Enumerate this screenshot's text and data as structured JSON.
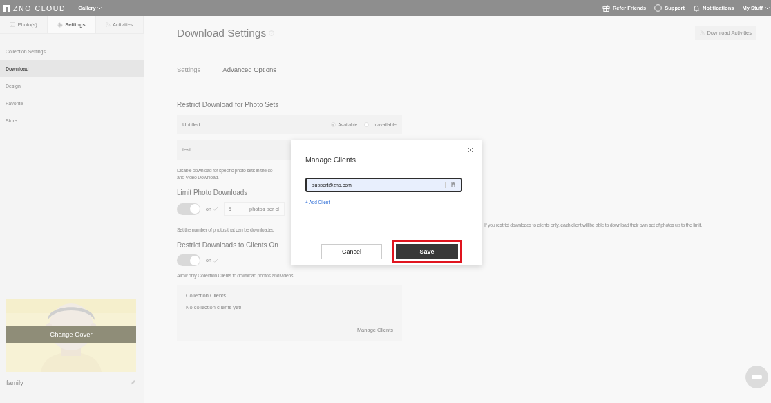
{
  "top_bar": {
    "logo": "ZNO CLOUD",
    "menu": "Gallery",
    "links": [
      {
        "kind": "gift",
        "label": "Refer Friends"
      },
      {
        "kind": "support",
        "label": "Support"
      },
      {
        "kind": "bell",
        "label": "Notifications"
      },
      {
        "kind": "dropdown",
        "label": "My Stuff"
      }
    ]
  },
  "sidebar": {
    "tabs": [
      {
        "label": "Photo(s)",
        "selected": false
      },
      {
        "kind": "gear",
        "label": "Settings",
        "selected": true
      },
      {
        "kind": "feed",
        "label": "Activities",
        "selected": false
      }
    ],
    "items": [
      {
        "label": "Collection Settings",
        "selected": false
      },
      {
        "label": "Download",
        "selected": true
      },
      {
        "label": "Design",
        "selected": false
      },
      {
        "label": "Favorite",
        "selected": false
      },
      {
        "label": "Store",
        "selected": false
      }
    ],
    "cover": {
      "kind": "picture",
      "caption": "Change Cover"
    },
    "collection_name": "family"
  },
  "main": {
    "title": "Download Settings",
    "action": "Download Activities",
    "tabs": [
      {
        "label": "Settings",
        "selected": false
      },
      {
        "label": "Advanced Options",
        "selected": true
      }
    ],
    "photo_sets": {
      "heading": "Restrict Download for Photo Sets",
      "rows": [
        {
          "name": "Untitled",
          "options": [
            {
              "label": "Available",
              "selected": true
            },
            {
              "label": "Unavailable",
              "selected": false
            }
          ]
        },
        {
          "name": "test"
        }
      ],
      "note_lines": [
        "Disable download for specific photo sets in the co",
        "and Video Download."
      ]
    },
    "limit": {
      "heading": "Limit Photo Downloads",
      "toggle": {
        "on": true,
        "label": "on"
      },
      "field": {
        "value": "5",
        "suffix": "photos per cl"
      },
      "note_left": "Set the number of photos that can be downloaded",
      "note_right": "If you restrict downloads to clients only, each client will be able to download their own set of photos up to the limit."
    },
    "clients": {
      "heading": "Restrict Downloads to Clients On",
      "toggle": {
        "on": true,
        "label": "on"
      },
      "note": "Allow only Collection Clients to download photos and videos.",
      "card": {
        "title": "Collection Clients",
        "empty": "No collection clients yet!",
        "action": "Manage Clients"
      }
    }
  },
  "modal": {
    "title": "Manage Clients",
    "clients": [
      {
        "value": "support@zno.com"
      }
    ],
    "add": "+ Add Client",
    "buttons": [
      {
        "kind": "secondary",
        "label": "Cancel",
        "highlighted": false
      },
      {
        "kind": "primary",
        "label": "Save",
        "highlighted": true
      }
    ]
  }
}
